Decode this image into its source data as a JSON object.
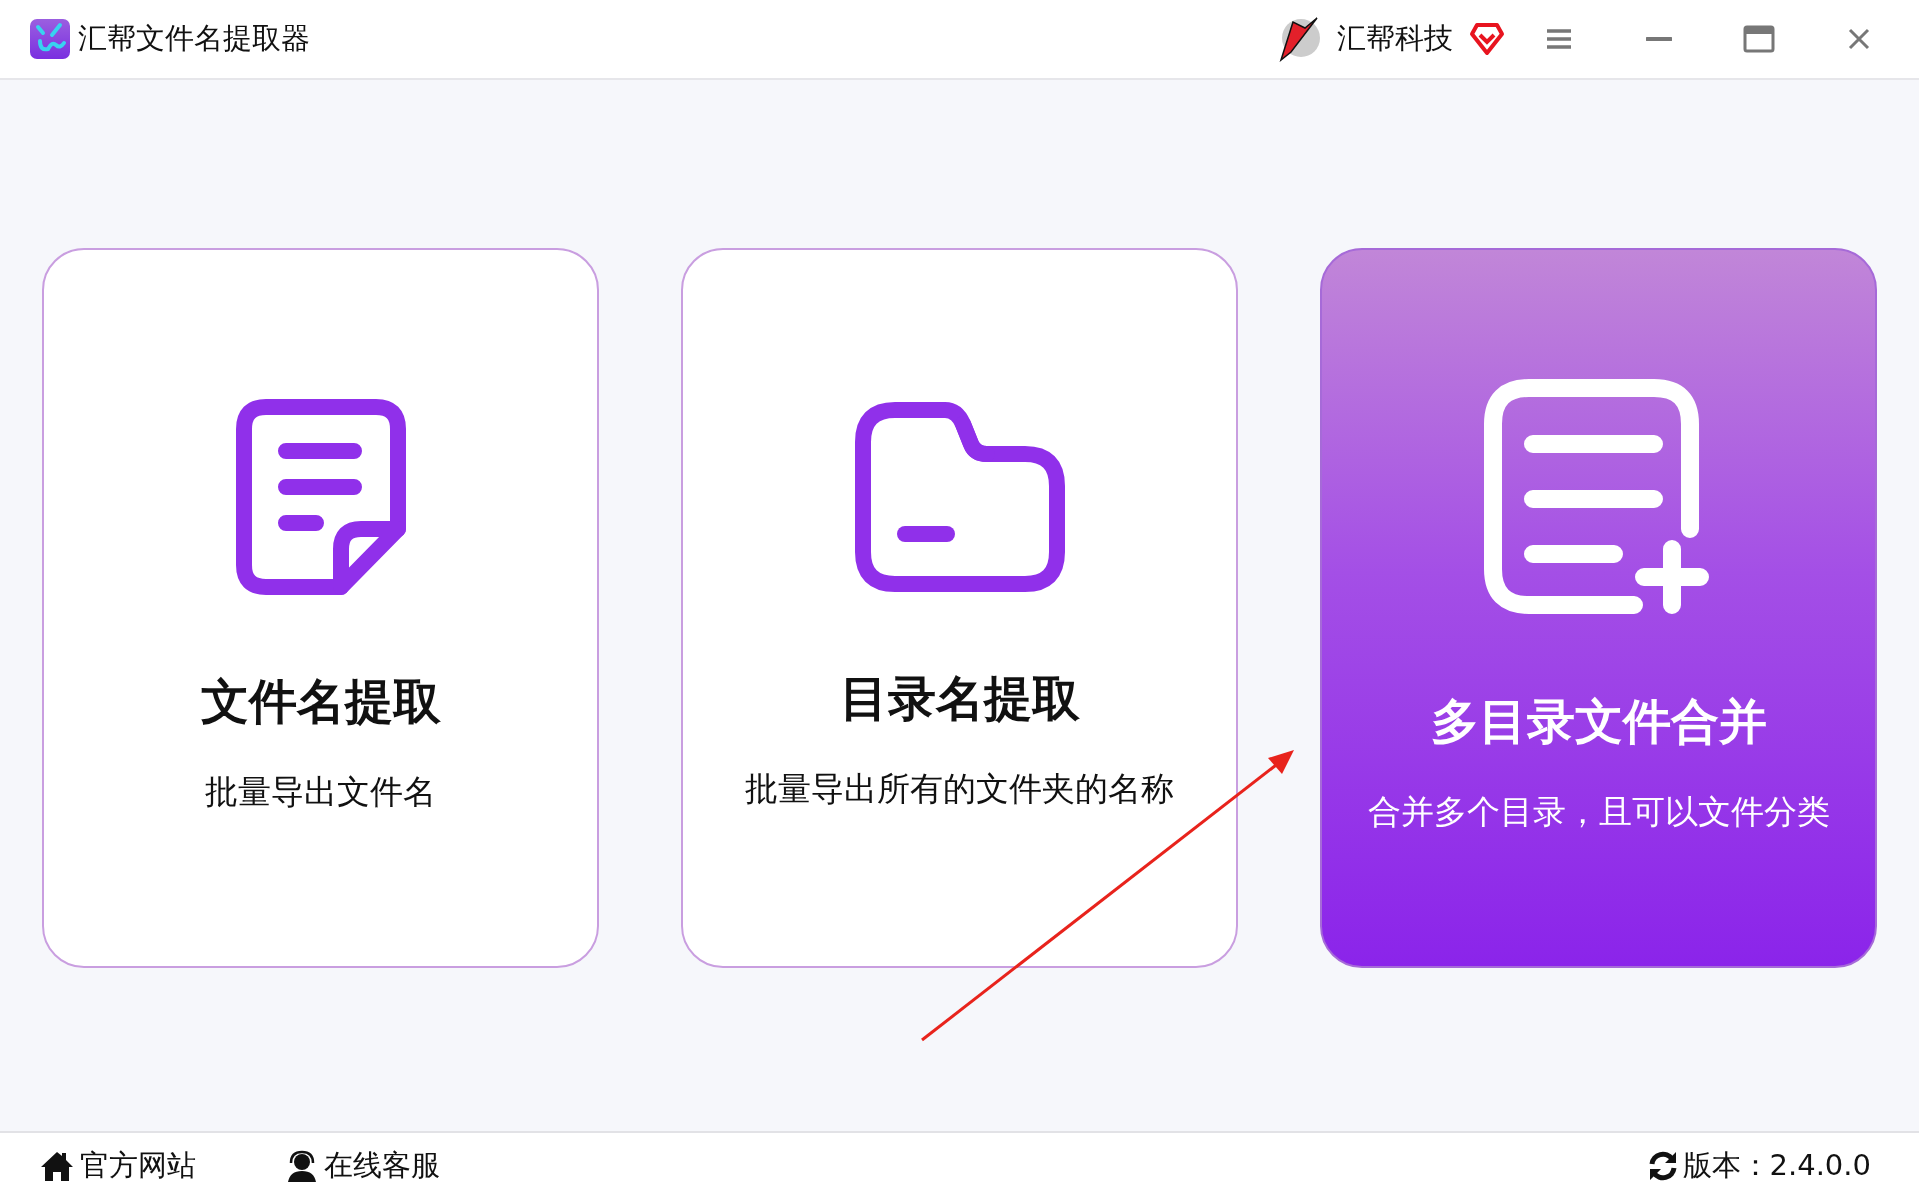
{
  "window": {
    "title": "汇帮文件名提取器",
    "brand": "汇帮科技"
  },
  "cards": [
    {
      "kind": "document",
      "title": "文件名提取",
      "subtitle": "批量导出文件名",
      "selected": false
    },
    {
      "kind": "folder",
      "title": "目录名提取",
      "subtitle": "批量导出所有的文件夹的名称",
      "selected": false
    },
    {
      "kind": "merge",
      "title": "多目录文件合并",
      "subtitle": "合并多个目录，且可以文件分类",
      "selected": true
    }
  ],
  "footer": {
    "links": [
      {
        "kind": "home",
        "label": "官方网站"
      },
      {
        "kind": "support",
        "label": "在线客服"
      }
    ],
    "version": "版本：2.4.0.0"
  }
}
